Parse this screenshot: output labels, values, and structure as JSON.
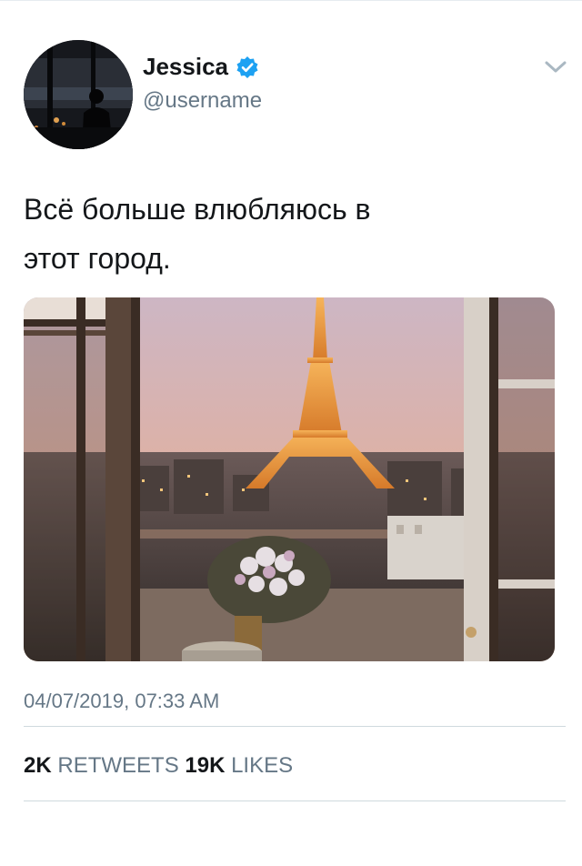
{
  "tweet": {
    "author": {
      "display_name": "Jessica",
      "handle": "@username",
      "verified": true
    },
    "text_lines": [
      "Всё больше влюбляюсь в",
      "этот город."
    ],
    "media": {
      "description_icon": "photo"
    },
    "timestamp": "04/07/2019, 07:33 AM",
    "stats": {
      "retweets_count": "2K",
      "retweets_label": "RETWEETS",
      "likes_count": "19K",
      "likes_label": "LIKES"
    }
  },
  "colors": {
    "text": "#14171a",
    "secondary": "#657786",
    "verified": "#1da1f2",
    "divider": "#cfd9de"
  },
  "icons": {
    "verified": "verified-badge-icon",
    "menu": "chevron-down-icon"
  }
}
